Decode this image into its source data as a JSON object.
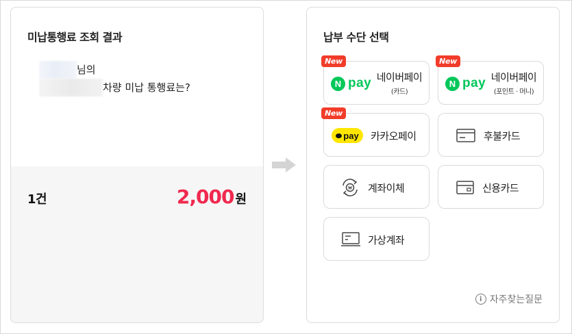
{
  "left": {
    "title": "미납통행료 조회 결과",
    "owner_suffix": "님의",
    "plate_suffix": "차량 미납 통행료는?",
    "count": "1건",
    "amount": "2,000",
    "currency": "원"
  },
  "right": {
    "title": "납부 수단 선택",
    "new_badge": "New",
    "options": {
      "naverpay_card": {
        "logo": "pay",
        "logo_n": "N",
        "label": "네이버페이",
        "sub": "(카드)"
      },
      "naverpay_point": {
        "logo": "pay",
        "logo_n": "N",
        "label": "네이버페이",
        "sub": "(포인트 · 머니)"
      },
      "kakaopay": {
        "logo": "pay",
        "label": "카카오페이"
      },
      "deferred_card": {
        "label": "후불카드",
        "icon": "card-icon"
      },
      "account_transfer": {
        "label": "계좌이체",
        "icon": "transfer-icon"
      },
      "credit_card": {
        "label": "신용카드",
        "icon": "credit-card-icon"
      },
      "virtual_account": {
        "label": "가상계좌",
        "icon": "virtual-account-icon"
      }
    },
    "faq": "자주찾는질문",
    "faq_icon": "i"
  },
  "colors": {
    "amount": "#f0294f",
    "naver_green": "#03c75a",
    "kakao_yellow": "#ffe600",
    "new_badge": "#f23c2a"
  }
}
